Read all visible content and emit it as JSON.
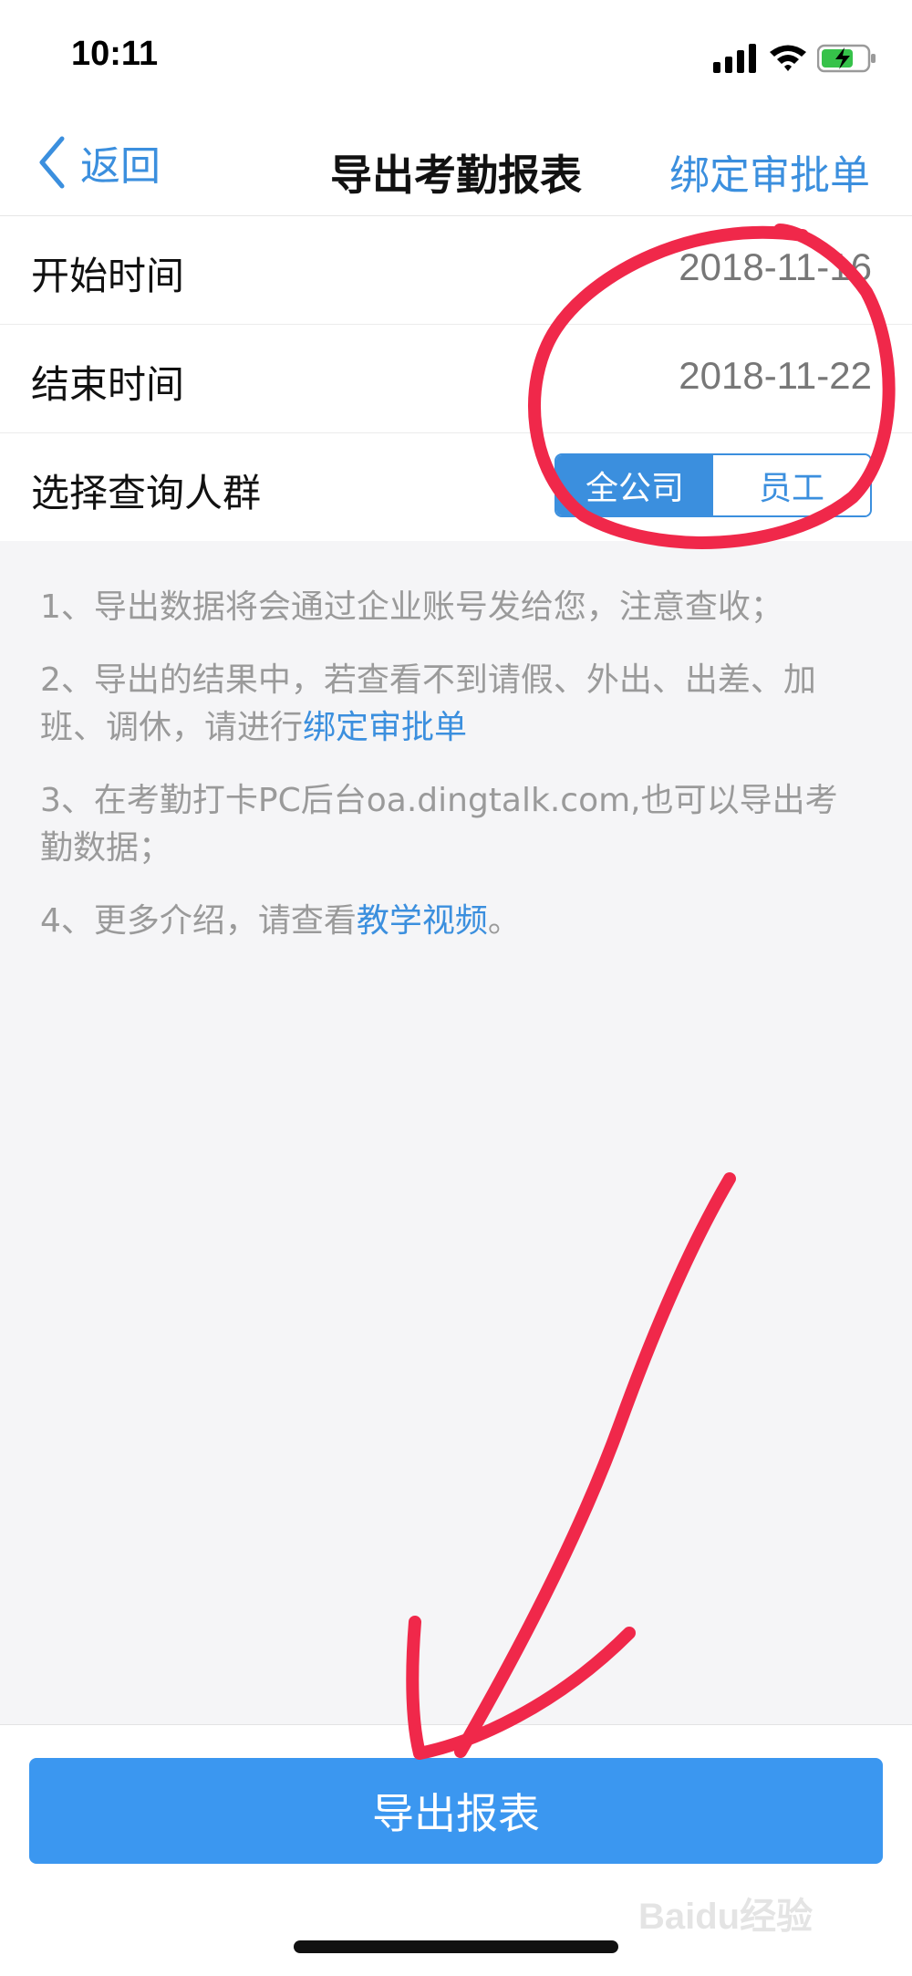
{
  "status": {
    "time": "10:11"
  },
  "nav": {
    "back_label": "返回",
    "title": "导出考勤报表",
    "right_action": "绑定审批单"
  },
  "form": {
    "start": {
      "label": "开始时间",
      "value": "2018-11-16"
    },
    "end": {
      "label": "结束时间",
      "value": "2018-11-22"
    },
    "group": {
      "label": "选择查询人群",
      "options": [
        "全公司",
        "员工"
      ],
      "selected": "全公司"
    }
  },
  "notes": {
    "n1": "1、导出数据将会通过企业账号发给您，注意查收；",
    "n2_text": "2、导出的结果中，若查看不到请假、外出、出差、加班、调休，请进行",
    "n2_link": "绑定审批单",
    "n3": "3、在考勤打卡PC后台oa.dingtalk.com,也可以导出考勤数据；",
    "n4_text": "4、更多介绍，请查看",
    "n4_link": "教学视频",
    "n4_end": "。"
  },
  "footer": {
    "export_label": "导出报表"
  },
  "watermark": {
    "text": "Baidu经验"
  },
  "colors": {
    "accent": "#3b8fde",
    "button": "#3b97f0",
    "annotation": "#f0284a"
  },
  "icons": [
    "back-chevron-icon",
    "signal-icon",
    "wifi-icon",
    "battery-charging-icon"
  ]
}
